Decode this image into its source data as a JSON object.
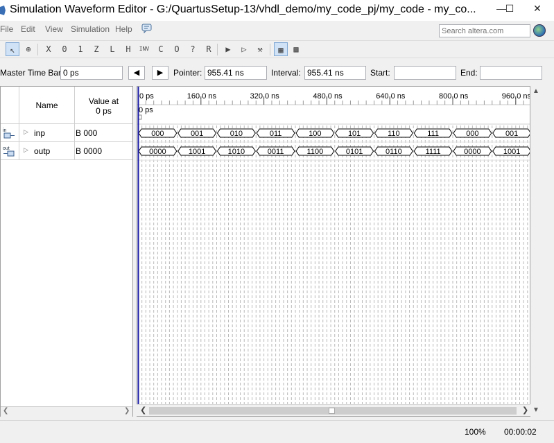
{
  "window": {
    "title": "Simulation Waveform Editor - G:/QuartusSetup-13/vhdl_demo/my_code_pj/my_code - my_co...",
    "minimize_glyph": "—",
    "maximize_glyph": "☐",
    "close_glyph": "✕"
  },
  "menu": {
    "items": [
      "File",
      "Edit",
      "View",
      "Simulation",
      "Help"
    ],
    "search_placeholder": "Search altera.com"
  },
  "toolbar": {
    "buttons": [
      {
        "icon": "pointer-icon",
        "glyph": "↖",
        "active": true
      },
      {
        "icon": "zoom-icon",
        "glyph": "⊕",
        "active": false
      },
      {
        "icon": "unknown-x-icon",
        "glyph": "X",
        "active": false
      },
      {
        "icon": "force-low-icon",
        "glyph": "0",
        "active": false
      },
      {
        "icon": "force-high-icon",
        "glyph": "1",
        "active": false
      },
      {
        "icon": "high-z-icon",
        "glyph": "Z",
        "active": false
      },
      {
        "icon": "weak-low-icon",
        "glyph": "L",
        "active": false
      },
      {
        "icon": "weak-high-icon",
        "glyph": "H",
        "active": false
      },
      {
        "icon": "invert-icon",
        "glyph": "INV",
        "active": false
      },
      {
        "icon": "count-value-icon",
        "glyph": "C",
        "active": false
      },
      {
        "icon": "overwrite-clock-icon",
        "glyph": "O",
        "active": false
      },
      {
        "icon": "arbitrary-value-icon",
        "glyph": "?",
        "active": false
      },
      {
        "icon": "random-value-icon",
        "glyph": "R",
        "active": false
      },
      {
        "icon": "functional-sim-icon",
        "glyph": "▶",
        "active": false
      },
      {
        "icon": "timing-sim-icon",
        "glyph": "▷",
        "active": false
      },
      {
        "icon": "netlist-icon",
        "glyph": "⚒",
        "active": false
      },
      {
        "icon": "snap-grid-icon",
        "glyph": "▦",
        "active": true
      },
      {
        "icon": "grid-icon",
        "glyph": "▩",
        "active": false
      }
    ]
  },
  "timebar": {
    "master_label": "Master Time Bar:",
    "master_value": "0 ps",
    "prev_glyph": "◀",
    "next_glyph": "▶",
    "pointer_label": "Pointer:",
    "pointer_value": "955.41 ns",
    "interval_label": "Interval:",
    "interval_value": "955.41 ns",
    "start_label": "Start:",
    "start_value": "",
    "end_label": "End:",
    "end_value": ""
  },
  "signal_table": {
    "name_header": "Name",
    "value_header_line1": "Value at",
    "value_header_line2": "0 ps",
    "signals": [
      {
        "direction_icon": "input-pin-icon",
        "icon_text": "in",
        "name": "inp",
        "value": "B 000"
      },
      {
        "direction_icon": "output-pin-icon",
        "icon_text": "out",
        "name": "outp",
        "value": "B 0000"
      }
    ]
  },
  "waveform": {
    "time_ticks": [
      "0 ps",
      "160.0 ns",
      "320.0 ns",
      "480.0 ns",
      "640.0 ns",
      "800.0 ns",
      "960.0 ns"
    ],
    "tick_values_ns": [
      0,
      160,
      320,
      480,
      640,
      800,
      960
    ],
    "cursor_label": "0 ps",
    "cursor_time_ns": 0,
    "visible_range_ns": [
      0,
      1000
    ],
    "segment_period_ns": 100,
    "grid_period_ns": 10,
    "traces": [
      {
        "signal": "inp",
        "values": [
          "000",
          "001",
          "010",
          "011",
          "100",
          "101",
          "110",
          "111",
          "000",
          "001"
        ]
      },
      {
        "signal": "outp",
        "values": [
          "0000",
          "1001",
          "1010",
          "0011",
          "1100",
          "0101",
          "0110",
          "1111",
          "0000",
          "1001"
        ]
      }
    ]
  },
  "statusbar": {
    "zoom": "100%",
    "elapsed": "00:00:02"
  },
  "colors": {
    "cursor": "#1a1aa6",
    "grid": "#b9b9b9",
    "trace": "#000000"
  }
}
